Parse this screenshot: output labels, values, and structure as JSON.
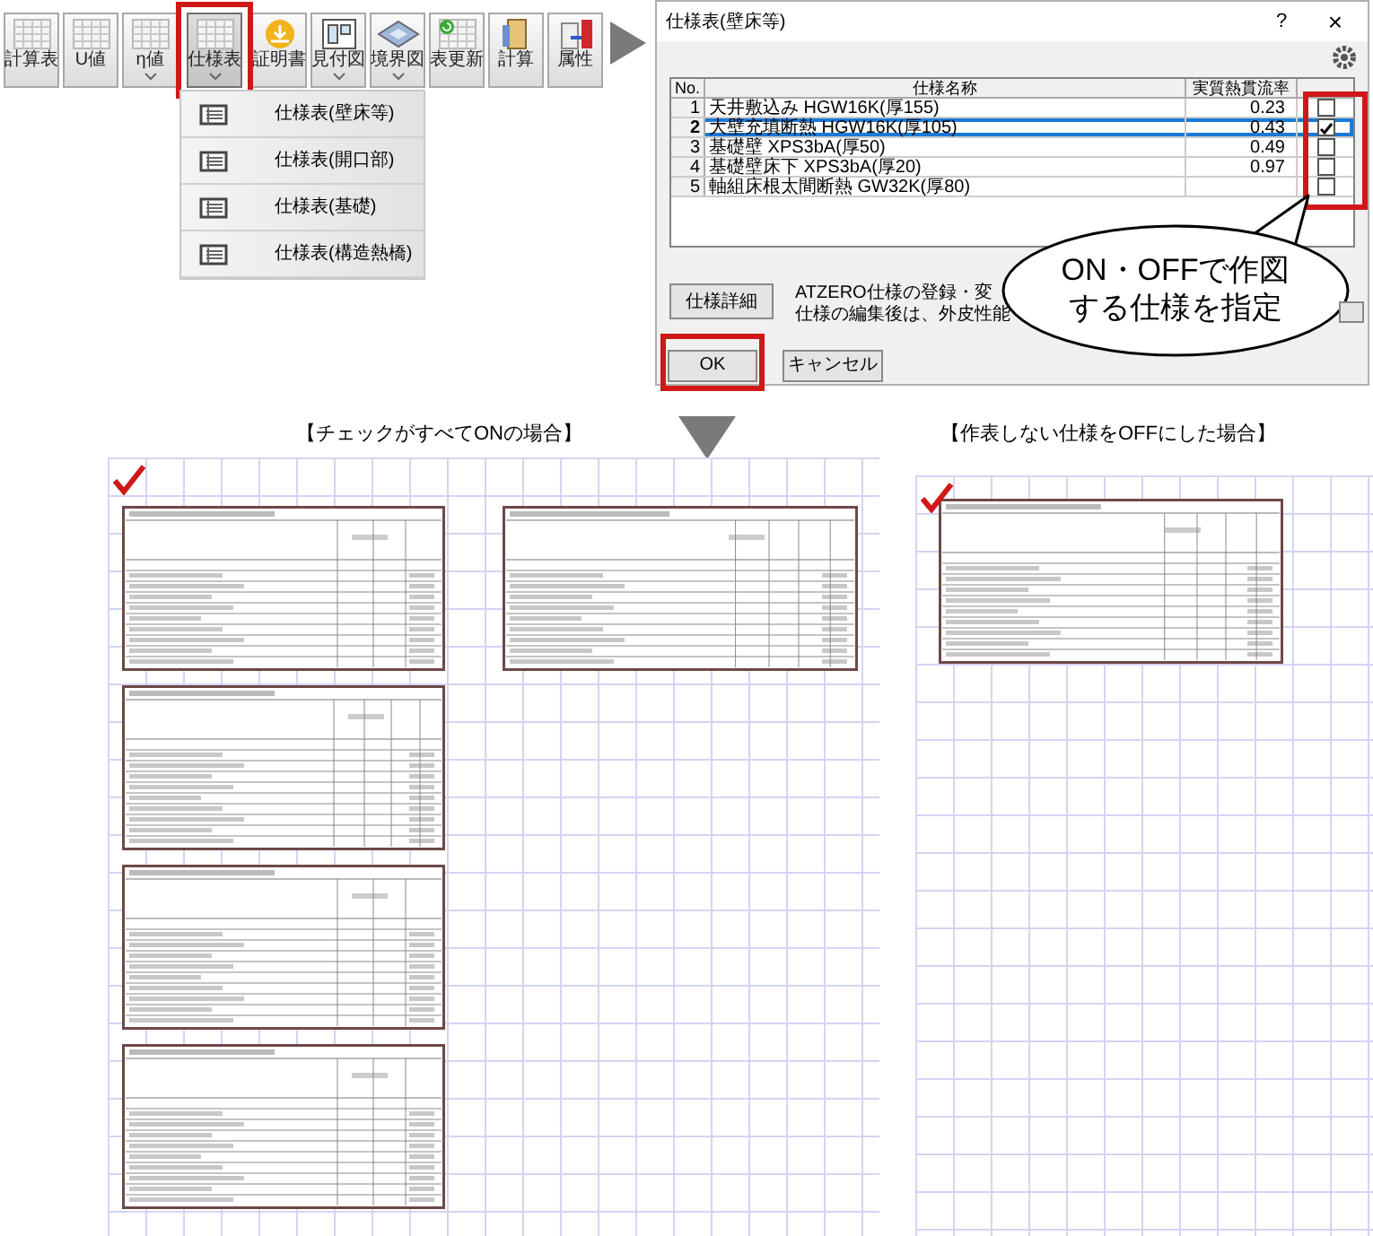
{
  "toolbar": {
    "buttons": [
      {
        "label": "計算表",
        "dropdown": false,
        "selected": false
      },
      {
        "label": "U値",
        "dropdown": false,
        "selected": false
      },
      {
        "label": "η値",
        "dropdown": true,
        "selected": false
      },
      {
        "label": "仕様表",
        "dropdown": true,
        "selected": true
      },
      {
        "label": "証明書",
        "dropdown": false,
        "selected": false
      },
      {
        "label": "見付図",
        "dropdown": true,
        "selected": false
      },
      {
        "label": "境界図",
        "dropdown": true,
        "selected": false
      },
      {
        "label": "表更新",
        "dropdown": false,
        "selected": false
      },
      {
        "label": "計算",
        "dropdown": false,
        "selected": false
      },
      {
        "label": "属性",
        "dropdown": false,
        "selected": false
      }
    ]
  },
  "dropdown_menu": {
    "items": [
      {
        "label": "仕様表(壁床等)"
      },
      {
        "label": "仕様表(開口部)"
      },
      {
        "label": "仕様表(基礎)"
      },
      {
        "label": "仕様表(構造熱橋)"
      }
    ]
  },
  "dialog": {
    "title": "仕様表(壁床等)",
    "help": "?",
    "close": "×",
    "table": {
      "columns": [
        "No.",
        "仕様名称",
        "実質熱貫流率"
      ],
      "rows": [
        {
          "no": "1",
          "name": "天井敷込み HGW16K(厚155)",
          "value": "0.23",
          "checked": false,
          "selected": false
        },
        {
          "no": "2",
          "name": "大壁充填断熱 HGW16K(厚105)",
          "value": "0.43",
          "checked": true,
          "selected": true
        },
        {
          "no": "3",
          "name": "基礎壁 XPS3bA(厚50)",
          "value": "0.49",
          "checked": false,
          "selected": false
        },
        {
          "no": "4",
          "name": "基礎壁床下 XPS3bA(厚20)",
          "value": "0.97",
          "checked": false,
          "selected": false
        },
        {
          "no": "5",
          "name": "軸組床根太間断熱 GW32K(厚80)",
          "checked": false,
          "selected": false
        }
      ]
    },
    "detail_button": "仕様詳細",
    "note_lines": [
      "ATZERO仕様の登録・変",
      "仕様の編集後は、外皮性能"
    ],
    "buttons": [
      {
        "label": "OK",
        "highlighted": true
      },
      {
        "label": "キャンセル",
        "highlighted": false
      }
    ]
  },
  "callout": {
    "lines": [
      "ON・OFFで作図",
      "する仕様を指定"
    ]
  },
  "captions": [
    "【チェックがすべてONの場合】",
    "【作表しない仕様をOFFにした場合】"
  ],
  "sheets": [
    {
      "columns": [
        {
          "tables": [
            {
              "kind": "single"
            },
            {
              "kind": "double"
            },
            {
              "kind": "single"
            },
            {
              "kind": "single"
            }
          ]
        },
        {
          "tables": [
            {
              "kind": "double"
            }
          ]
        }
      ]
    },
    {
      "columns": [
        {
          "tables": [
            {
              "kind": "double"
            }
          ]
        }
      ]
    }
  ]
}
